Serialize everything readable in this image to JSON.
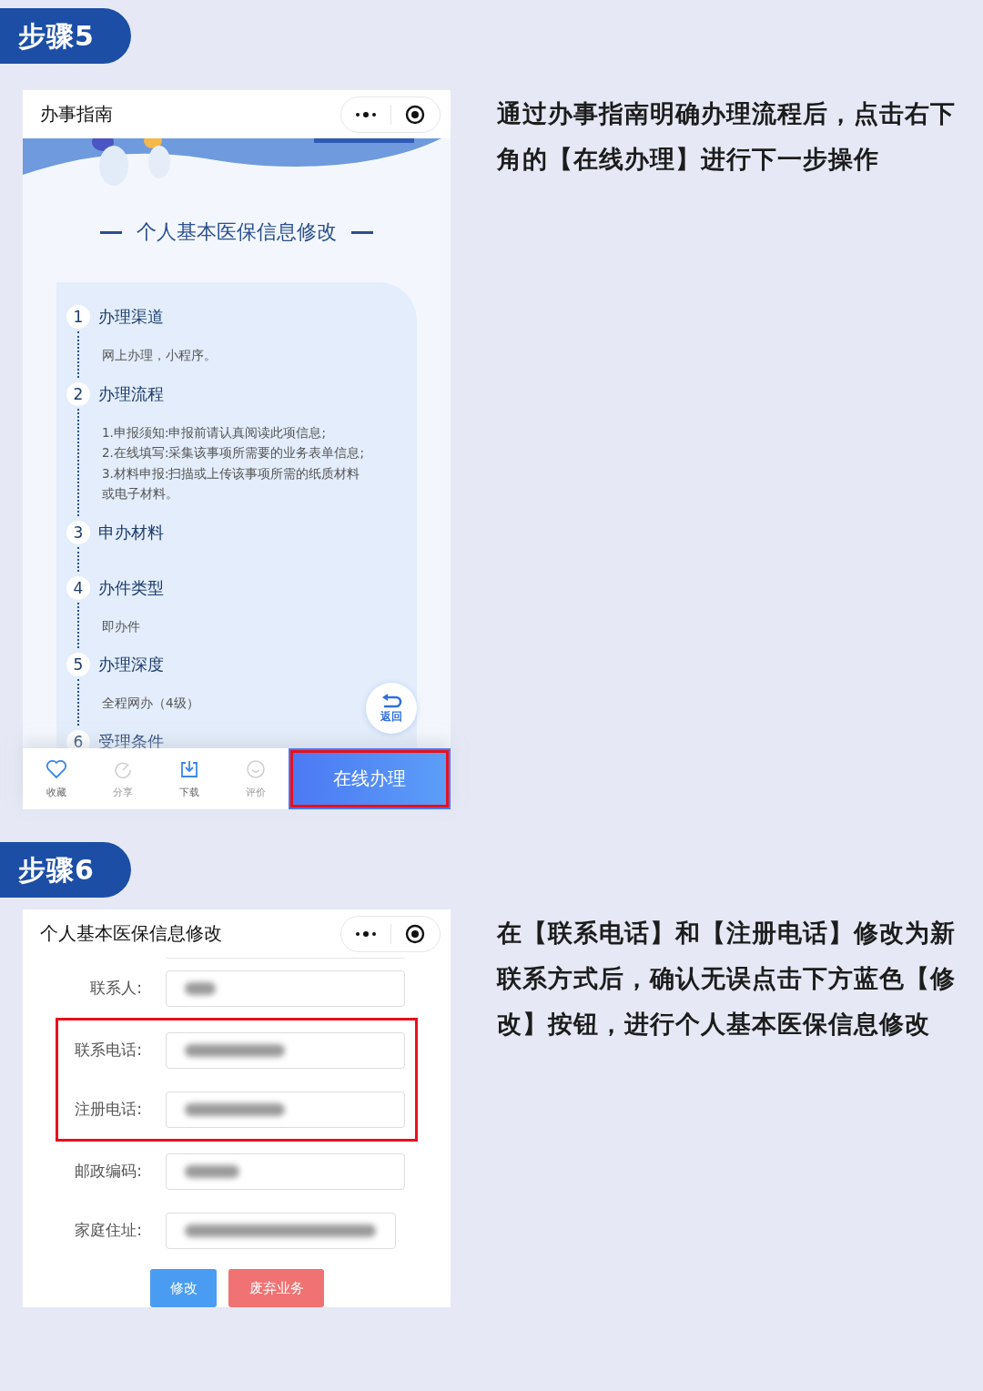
{
  "sections": [
    {
      "badge": "步骤5",
      "instruction": "通过办事指南明确办理流程后，点击右下角的【在线办理】进行下一步操作",
      "kind": "guide",
      "screen": {
        "title": "办事指南",
        "heading": "个人基本医保信息修改",
        "steps": [
          {
            "number": "1",
            "title": "办理渠道",
            "details": [
              "网上办理，小程序。"
            ]
          },
          {
            "number": "2",
            "title": "办理流程",
            "details": [
              "1.申报须知:申报前请认真阅读此项信息;",
              "2.在线填写:采集该事项所需要的业务表单信息;",
              "3.材料申报:扫描或上传该事项所需的纸质材料或电子材料。"
            ]
          },
          {
            "number": "3",
            "title": "申办材料"
          },
          {
            "number": "4",
            "title": "办件类型",
            "details": [
              "即办件"
            ]
          },
          {
            "number": "5",
            "title": "办理深度",
            "details": [
              "全程网办（4级）"
            ]
          },
          {
            "number": "6",
            "title": "受理条件"
          }
        ],
        "back_button": "返回",
        "toolbar": [
          {
            "label": "收藏",
            "disabled": false
          },
          {
            "label": "分享",
            "disabled": true
          },
          {
            "label": "下载",
            "disabled": false
          },
          {
            "label": "评价",
            "disabled": true
          }
        ],
        "primary_button": {
          "label": "在线办理",
          "highlighted": true
        }
      }
    },
    {
      "badge": "步骤6",
      "instruction": "在【联系电话】和【注册电话】修改为新联系方式后，确认无误点击下方蓝色【修改】按钮，进行个人基本医保信息修改",
      "kind": "form",
      "screen": {
        "title": "个人基本医保信息修改",
        "fields": [
          {
            "label": "联系人:",
            "highlighted": false
          },
          {
            "label": "联系电话:",
            "highlighted": true
          },
          {
            "label": "注册电话:",
            "highlighted": true
          },
          {
            "label": "邮政编码:",
            "highlighted": false
          },
          {
            "label": "家庭住址:",
            "highlighted": false
          }
        ],
        "buttons": [
          {
            "label": "修改",
            "kind": "primary"
          },
          {
            "label": "废弃业务",
            "kind": "danger"
          }
        ]
      }
    }
  ]
}
